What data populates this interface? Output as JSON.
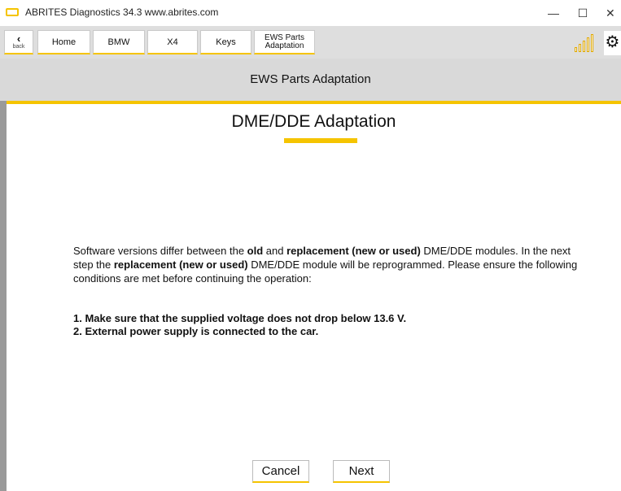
{
  "window": {
    "title": "ABRITES Diagnostics 34.3   www.abrites.com",
    "minimize_glyph": "—",
    "maximize_glyph": "☐",
    "close_glyph": "✕"
  },
  "nav": {
    "back_label": "back",
    "back_glyph": "‹",
    "items": [
      "Home",
      "BMW",
      "X4",
      "Keys"
    ],
    "ews_line1": "EWS Parts",
    "ews_line2": "Adaptation",
    "gear_glyph": "⚙"
  },
  "page": {
    "header_title": "EWS Parts Adaptation",
    "heading": "DME/DDE Adaptation",
    "body": {
      "p1": "Software versions differ between the ",
      "b1": "old",
      "p2": " and ",
      "b2": "replacement (new or used)",
      "p3": " DME/DDE modules. In the next step the ",
      "b3": "replacement (new or used)",
      "p4": " DME/DDE module will be reprogrammed. Please ensure the following conditions are met before continuing the operation:"
    },
    "conditions": [
      "1. Make sure that the supplied voltage does not drop below 13.6 V.",
      "2. External power supply is connected to the car."
    ]
  },
  "buttons": {
    "cancel": "Cancel",
    "next": "Next"
  },
  "colors": {
    "accent": "#f5c400",
    "nav_bg": "#dedede",
    "header_bg": "#d9d9d9",
    "frame": "#9a9a9a"
  }
}
